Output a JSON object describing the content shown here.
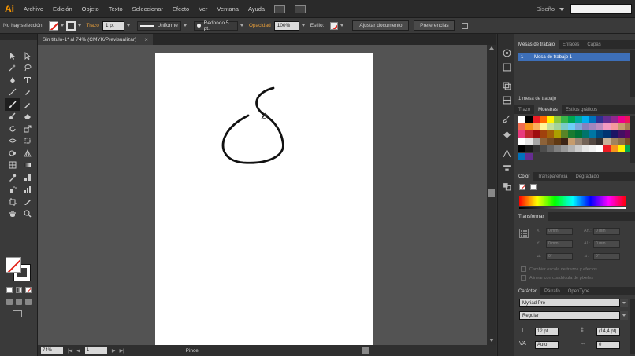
{
  "app": {
    "logo_text": "Ai",
    "menu": [
      "Archivo",
      "Edición",
      "Objeto",
      "Texto",
      "Seleccionar",
      "Efecto",
      "Ver",
      "Ventana",
      "Ayuda"
    ],
    "workspace": "Diseño",
    "search_placeholder": ""
  },
  "control_bar": {
    "selection": "No hay selección",
    "stroke_label": "Trazo",
    "stroke_weight": "1 pt",
    "stroke_profile": "Uniforme",
    "brush": "Redondo 5 pt.",
    "opacity_label": "Opacidad",
    "opacity_value": "100%",
    "style_label": "Estilo:",
    "doc_setup_button": "Ajustar documento",
    "preferences_button": "Preferencias"
  },
  "document": {
    "tab_title": "Sin título-1* al 74% (CMYK/Previsualizar)",
    "close_glyph": "×"
  },
  "status_bar": {
    "zoom": "74%",
    "page": "1",
    "current_tool": "Pincel"
  },
  "panels": {
    "artboards": {
      "tabs": [
        "Mesas de trabajo",
        "Enlaces",
        "Capas"
      ],
      "rows": [
        {
          "num": "1",
          "name": "Mesa de trabajo 1"
        }
      ],
      "footer": "1 mesa de trabajo"
    },
    "swatches": {
      "tabs": [
        "Trazo",
        "Muestras",
        "Estilos gráficos"
      ],
      "colors": [
        "#ffffff",
        "#000000",
        "#ed1c24",
        "#ff6a00",
        "#fff200",
        "#8cc63f",
        "#39b54a",
        "#00a651",
        "#00a99d",
        "#00aeef",
        "#0072bc",
        "#2e3192",
        "#662d91",
        "#92278f",
        "#ec008c",
        "#ed145b",
        "#f26c4f",
        "#f7941d",
        "#fbaf5d",
        "#fff799",
        "#c4df9b",
        "#a3d39c",
        "#7accc8",
        "#6dcff6",
        "#7da7d9",
        "#8781bd",
        "#a186be",
        "#bd8cbf",
        "#f49ac1",
        "#f6989d",
        "#c69c6d",
        "#a67c52",
        "#e83a7e",
        "#c1272d",
        "#9e0b0f",
        "#a0410d",
        "#a36209",
        "#aba000",
        "#598527",
        "#197b30",
        "#007236",
        "#00746b",
        "#0076a3",
        "#004a80",
        "#003471",
        "#1b1464",
        "#440e62",
        "#630460",
        "#ffffff",
        "#e6e6e6",
        "#a6a6a6",
        "#8c6239",
        "#754c24",
        "#603913",
        "#3c2415",
        "#c69c6d",
        "#998675",
        "#736357",
        "#534741",
        "#362f2d",
        "#c7b299",
        "#a0835e",
        "#8b6f47",
        "#754c24",
        "#000000",
        "#1a1a1a",
        "#333333",
        "#4d4d4d",
        "#666666",
        "#808080",
        "#999999",
        "#b3b3b3",
        "#cccccc",
        "#e6e6e6",
        "#f2f2f2",
        "#ffffff",
        "#ed1c24",
        "#f7941d",
        "#fff200",
        "#00a651",
        "#0072bc",
        "#662d91"
      ]
    },
    "color": {
      "tabs": [
        "Color",
        "Transparencia",
        "Degradado"
      ]
    },
    "transform": {
      "tabs": [
        "Transformar"
      ],
      "fields": [
        {
          "label": "X:",
          "value": "0 mm"
        },
        {
          "label": "An.:",
          "value": "0 mm"
        },
        {
          "label": "Y:",
          "value": "0 mm"
        },
        {
          "label": "Al.:",
          "value": "0 mm"
        },
        {
          "label": "⊿:",
          "value": "0°"
        },
        {
          "label": "⊿:",
          "value": "0°"
        }
      ],
      "check1": "Cambiar escala de trazos y efectos",
      "check2": "Alinear con cuadrícula de píxeles"
    },
    "character": {
      "tabs": [
        "Carácter",
        "Párrafo",
        "OpenType"
      ],
      "font": "Myriad Pro",
      "style": "Regular",
      "size": "12 pt",
      "leading": "(14,4 pt)",
      "kerning": "Auto",
      "tracking": "0"
    }
  }
}
